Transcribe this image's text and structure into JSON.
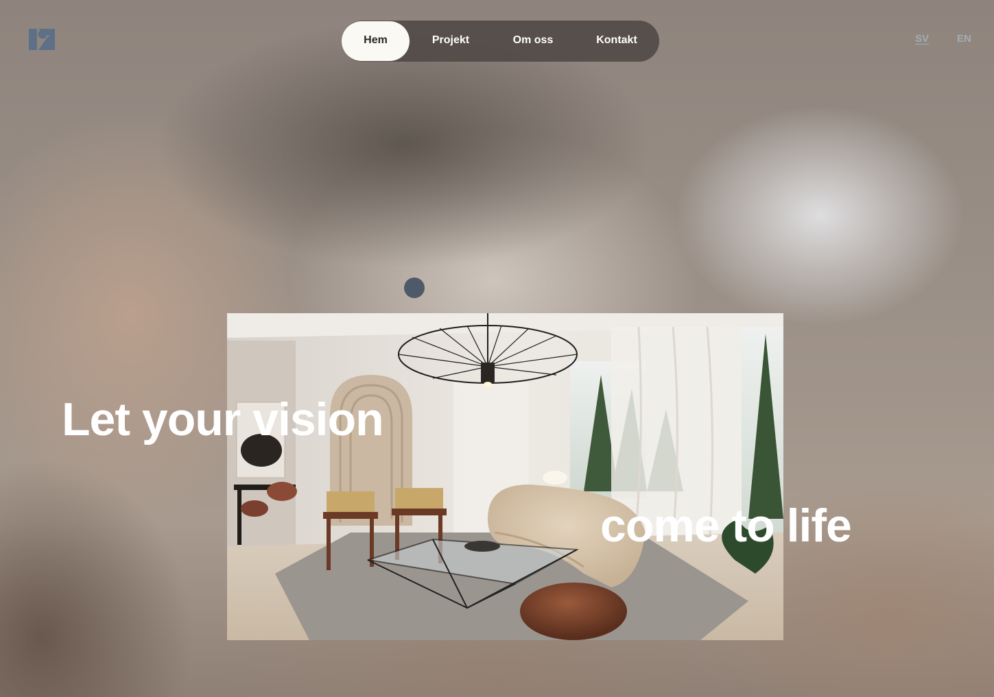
{
  "brand": {
    "logo_icon": "studio-logo-icon",
    "logo_color": "#5e7088"
  },
  "nav": {
    "items": [
      {
        "label": "Hem",
        "active": true
      },
      {
        "label": "Projekt",
        "active": false
      },
      {
        "label": "Om oss",
        "active": false
      },
      {
        "label": "Kontakt",
        "active": false
      }
    ]
  },
  "language": {
    "options": [
      "SV",
      "EN"
    ],
    "selected": "SV"
  },
  "hero": {
    "headline_line1": "Let your vision",
    "headline_line2": "come to life",
    "image_icon": "living-room-interior-photo",
    "cursor_icon": "cursor-dot-icon",
    "colors": {
      "accent": "#4f5a68",
      "nav_background": "#4e4844",
      "nav_active": "#fbf9f4",
      "language_text": "#a3acb6"
    }
  }
}
